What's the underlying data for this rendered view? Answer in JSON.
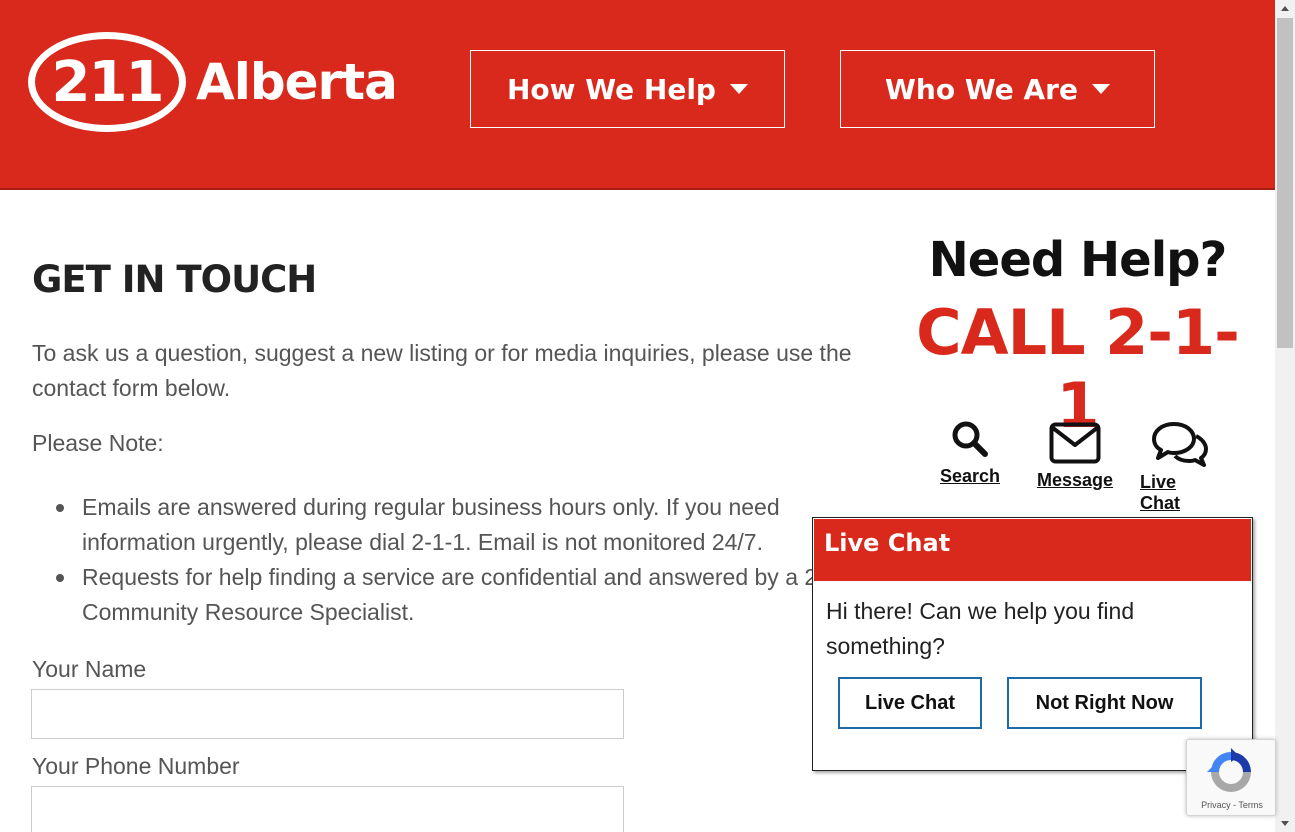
{
  "header": {
    "logo_number": "211",
    "logo_text": "Alberta",
    "nav": [
      {
        "label": "How We Help"
      },
      {
        "label": "Who We Are"
      }
    ]
  },
  "main": {
    "title": "GET IN TOUCH",
    "intro": "To ask us a question, suggest a new listing or for media inquiries, please use the contact form below.",
    "note_label": "Please Note:",
    "notes": [
      "Emails are answered during regular business hours only. If you need information urgently, please dial 2-1-1. Email is not monitored 24/7.",
      "Requests for help finding a service are confidential and answered by a 211 Community Resource Specialist."
    ],
    "fields": {
      "name_label": "Your Name",
      "name_value": "",
      "phone_label": "Your Phone Number",
      "phone_value": ""
    }
  },
  "sidebar": {
    "need_help": "Need Help?",
    "call": "CALL 2-1-1",
    "links": [
      {
        "label": "Search",
        "icon": "search-icon"
      },
      {
        "label": "Message",
        "icon": "envelope-icon"
      },
      {
        "label": "Live Chat",
        "icon": "chat-bubbles-icon"
      }
    ]
  },
  "chat_popup": {
    "title": "Live Chat",
    "message": "Hi there! Can we help you find something?",
    "live_chat_label": "Live Chat",
    "not_now_label": "Not Right Now"
  },
  "recaptcha": {
    "text": "Privacy - Terms"
  },
  "colors": {
    "brand_red": "#d9291c",
    "button_border": "#1e6aa6"
  }
}
